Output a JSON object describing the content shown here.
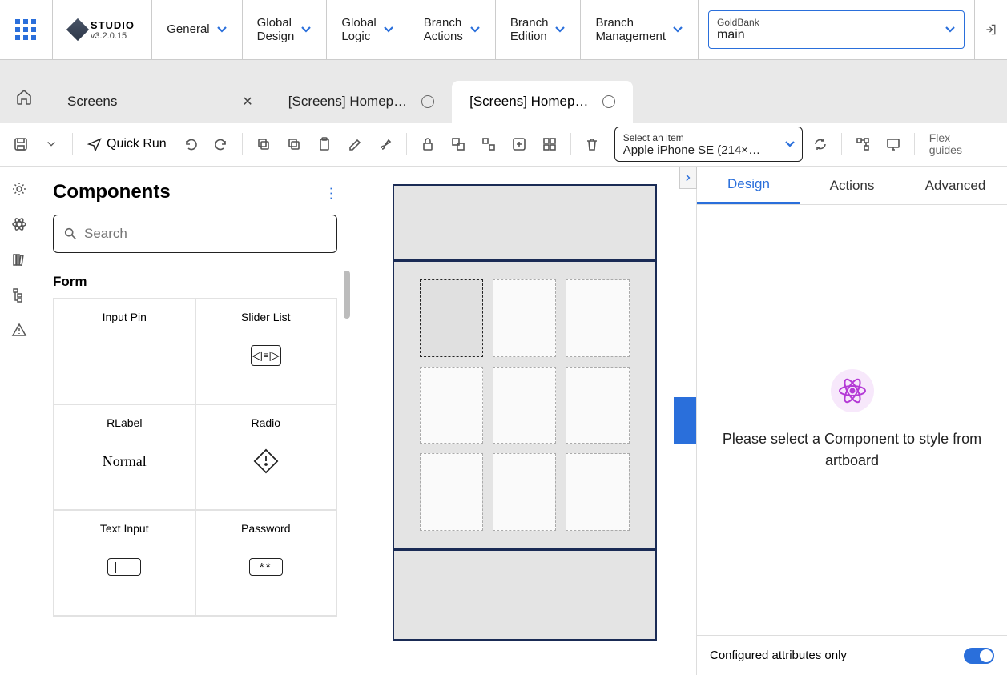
{
  "app": {
    "title": "STUDIO",
    "version": "v3.2.0.15"
  },
  "menus": [
    {
      "label": "General"
    },
    {
      "label": "Global\nDesign"
    },
    {
      "label": "Global\nLogic"
    },
    {
      "label": "Branch\nActions"
    },
    {
      "label": "Branch\nEdition"
    },
    {
      "label": "Branch\nManagement"
    }
  ],
  "branchSelect": {
    "label": "GoldBank",
    "value": "main"
  },
  "tabs": {
    "screens": {
      "label": "Screens"
    },
    "tab1": {
      "label": "[Screens] Homep…"
    },
    "tab2": {
      "label": "[Screens] Homep…"
    }
  },
  "toolbar": {
    "quickRun": "Quick Run",
    "deviceSelect": {
      "label": "Select an item",
      "value": "Apple iPhone SE (214×…"
    },
    "flexGuides": "Flex\nguides"
  },
  "componentsPanel": {
    "title": "Components",
    "searchPlaceholder": "Search",
    "sections": {
      "form": {
        "title": "Form",
        "items": [
          {
            "label": "Input Pin"
          },
          {
            "label": "Slider List"
          },
          {
            "label": "RLabel",
            "caption": "Normal"
          },
          {
            "label": "Radio"
          },
          {
            "label": "Text Input"
          },
          {
            "label": "Password",
            "caption": "**"
          }
        ]
      }
    }
  },
  "rightPanel": {
    "tabs": {
      "design": "Design",
      "actions": "Actions",
      "advanced": "Advanced"
    },
    "message": "Please select a Component to style from artboard",
    "footerLabel": "Configured attributes only"
  }
}
